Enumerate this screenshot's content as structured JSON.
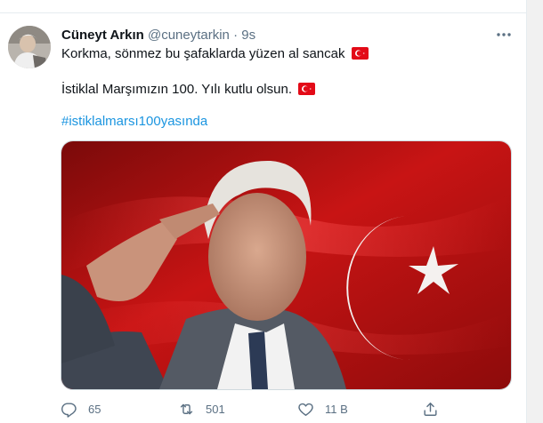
{
  "tweet": {
    "author_name": "Cüneyt Arkın",
    "handle": "@cuneytarkin",
    "separator": "·",
    "time": "9s",
    "line1": "Korkma, sönmez bu şafaklarda yüzen al sancak",
    "line2": "İstiklal Marşımızın 100. Yılı kutlu olsun.",
    "hashtag": "#istiklalmarsı100yasında",
    "reply_count": "65",
    "retweet_count": "501",
    "like_count": "11 B"
  },
  "colors": {
    "link": "#1b95e0",
    "muted": "#5b7083",
    "flag_red": "#e30a17"
  },
  "icons": [
    "more-icon",
    "flag-tr-icon",
    "reply-icon",
    "retweet-icon",
    "like-icon",
    "share-icon"
  ]
}
